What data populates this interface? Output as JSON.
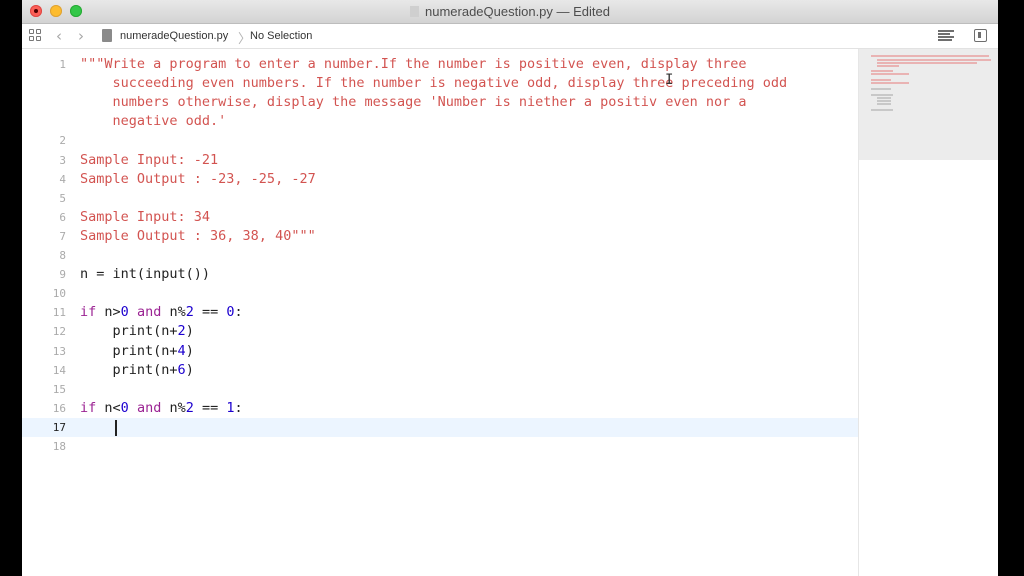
{
  "window": {
    "title": "numeradeQuestion.py — Edited"
  },
  "jumpbar": {
    "back_icon": "chevron-left-icon",
    "forward_icon": "chevron-right-icon",
    "file_name": "numeradeQuestion.py",
    "separator": "〉",
    "selection": "No Selection"
  },
  "editor": {
    "current_line": 17,
    "gutter": [
      "1",
      "2",
      "3",
      "4",
      "5",
      "6",
      "7",
      "8",
      "9",
      "10",
      "11",
      "12",
      "13",
      "14",
      "15",
      "16",
      "17",
      "18"
    ],
    "lines": [
      {
        "n": "1",
        "segments": [
          {
            "cls": "str",
            "text": "\"\"\"Write a program to enter a number.If the number is positive even, display three"
          }
        ]
      },
      {
        "n": "",
        "segments": [
          {
            "cls": "str",
            "text": "    succeeding even numbers. If the number is negative odd, display three preceding odd"
          }
        ]
      },
      {
        "n": "",
        "segments": [
          {
            "cls": "str",
            "text": "    numbers otherwise, display the message 'Number is niether a positiv even nor a"
          }
        ]
      },
      {
        "n": "",
        "segments": [
          {
            "cls": "str",
            "text": "    negative odd.'"
          }
        ]
      },
      {
        "n": "2",
        "segments": []
      },
      {
        "n": "3",
        "segments": [
          {
            "cls": "str",
            "text": "Sample Input: -21"
          }
        ]
      },
      {
        "n": "4",
        "segments": [
          {
            "cls": "str",
            "text": "Sample Output : -23, -25, -27"
          }
        ]
      },
      {
        "n": "5",
        "segments": []
      },
      {
        "n": "6",
        "segments": [
          {
            "cls": "str",
            "text": "Sample Input: 34"
          }
        ]
      },
      {
        "n": "7",
        "segments": [
          {
            "cls": "str",
            "text": "Sample Output : 36, 38, 40\"\"\""
          }
        ]
      },
      {
        "n": "8",
        "segments": []
      },
      {
        "n": "9",
        "segments": [
          {
            "cls": "plain",
            "text": "n = int(input())"
          }
        ]
      },
      {
        "n": "10",
        "segments": []
      },
      {
        "n": "11",
        "segments": [
          {
            "cls": "kw",
            "text": "if"
          },
          {
            "cls": "plain",
            "text": " n>"
          },
          {
            "cls": "num",
            "text": "0"
          },
          {
            "cls": "plain",
            "text": " "
          },
          {
            "cls": "kw",
            "text": "and"
          },
          {
            "cls": "plain",
            "text": " n%"
          },
          {
            "cls": "num",
            "text": "2"
          },
          {
            "cls": "plain",
            "text": " == "
          },
          {
            "cls": "num",
            "text": "0"
          },
          {
            "cls": "plain",
            "text": ":"
          }
        ]
      },
      {
        "n": "12",
        "segments": [
          {
            "cls": "plain",
            "text": "    print(n+"
          },
          {
            "cls": "num",
            "text": "2"
          },
          {
            "cls": "plain",
            "text": ")"
          }
        ]
      },
      {
        "n": "13",
        "segments": [
          {
            "cls": "plain",
            "text": "    print(n+"
          },
          {
            "cls": "num",
            "text": "4"
          },
          {
            "cls": "plain",
            "text": ")"
          }
        ]
      },
      {
        "n": "14",
        "segments": [
          {
            "cls": "plain",
            "text": "    print(n+"
          },
          {
            "cls": "num",
            "text": "6"
          },
          {
            "cls": "plain",
            "text": ")"
          }
        ]
      },
      {
        "n": "15",
        "segments": []
      },
      {
        "n": "16",
        "segments": [
          {
            "cls": "kw",
            "text": "if"
          },
          {
            "cls": "plain",
            "text": " n<"
          },
          {
            "cls": "num",
            "text": "0"
          },
          {
            "cls": "plain",
            "text": " "
          },
          {
            "cls": "kw",
            "text": "and"
          },
          {
            "cls": "plain",
            "text": " n%"
          },
          {
            "cls": "num",
            "text": "2"
          },
          {
            "cls": "plain",
            "text": " == "
          },
          {
            "cls": "num",
            "text": "1"
          },
          {
            "cls": "plain",
            "text": ":"
          }
        ]
      },
      {
        "n": "17",
        "segments": [
          {
            "cls": "plain",
            "text": "    "
          }
        ]
      },
      {
        "n": "18",
        "segments": []
      }
    ]
  },
  "colors": {
    "string": "#c41a16",
    "keyword": "#9b2393",
    "number": "#1c00cf",
    "current_line_bg": "#ecf5ff"
  }
}
